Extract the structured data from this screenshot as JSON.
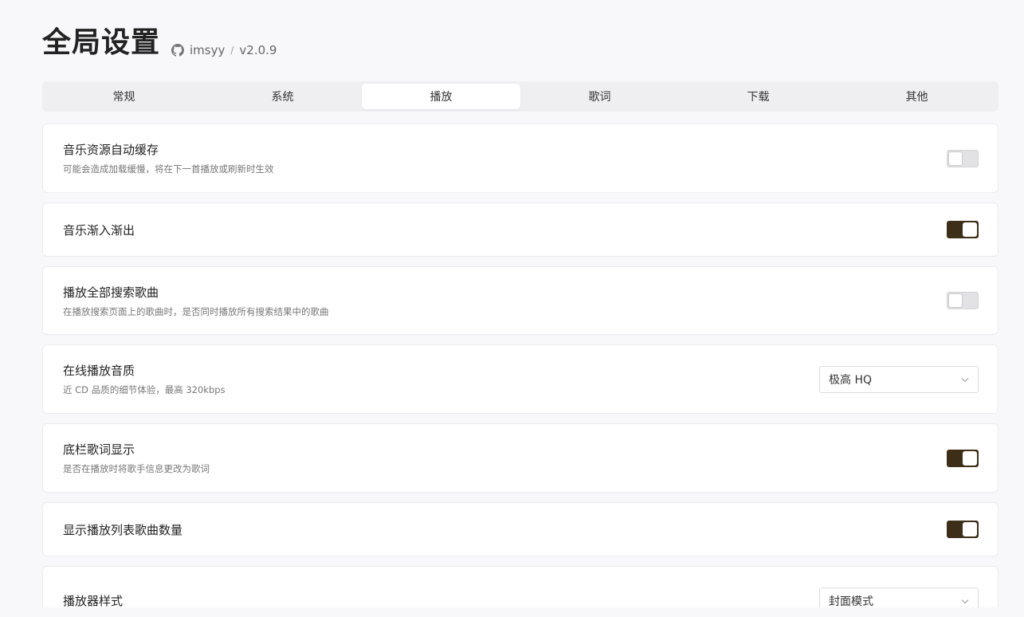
{
  "header": {
    "title": "全局设置",
    "author": "imsyy",
    "separator": "/",
    "version": "v2.0.9"
  },
  "tabs": [
    {
      "label": "常规",
      "active": false
    },
    {
      "label": "系统",
      "active": false
    },
    {
      "label": "播放",
      "active": true
    },
    {
      "label": "歌词",
      "active": false
    },
    {
      "label": "下载",
      "active": false
    },
    {
      "label": "其他",
      "active": false
    }
  ],
  "settings": [
    {
      "name": "音乐资源自动缓存",
      "desc": "可能会造成加载缓慢，将在下一首播放或刷新时生效",
      "control": "switch",
      "value": false
    },
    {
      "name": "音乐渐入渐出",
      "desc": "",
      "control": "switch",
      "value": true
    },
    {
      "name": "播放全部搜索歌曲",
      "desc": "在播放搜索页面上的歌曲时，是否同时播放所有搜索结果中的歌曲",
      "control": "switch",
      "value": false
    },
    {
      "name": "在线播放音质",
      "desc": "近 CD 品质的细节体验，最高 320kbps",
      "control": "select",
      "value": "极高 HQ"
    },
    {
      "name": "底栏歌词显示",
      "desc": "是否在播放时将歌手信息更改为歌词",
      "control": "switch",
      "value": true
    },
    {
      "name": "显示播放列表歌曲数量",
      "desc": "",
      "control": "switch",
      "value": true
    },
    {
      "name": "播放器样式",
      "desc": "",
      "control": "select",
      "value": "封面模式"
    }
  ],
  "colors": {
    "switch_on": "#3d2e18",
    "switch_off": "#e2e2e4",
    "background": "#f8f8fa"
  },
  "icons": {
    "github": "github-icon",
    "dropdown": "chevron-down-icon"
  }
}
